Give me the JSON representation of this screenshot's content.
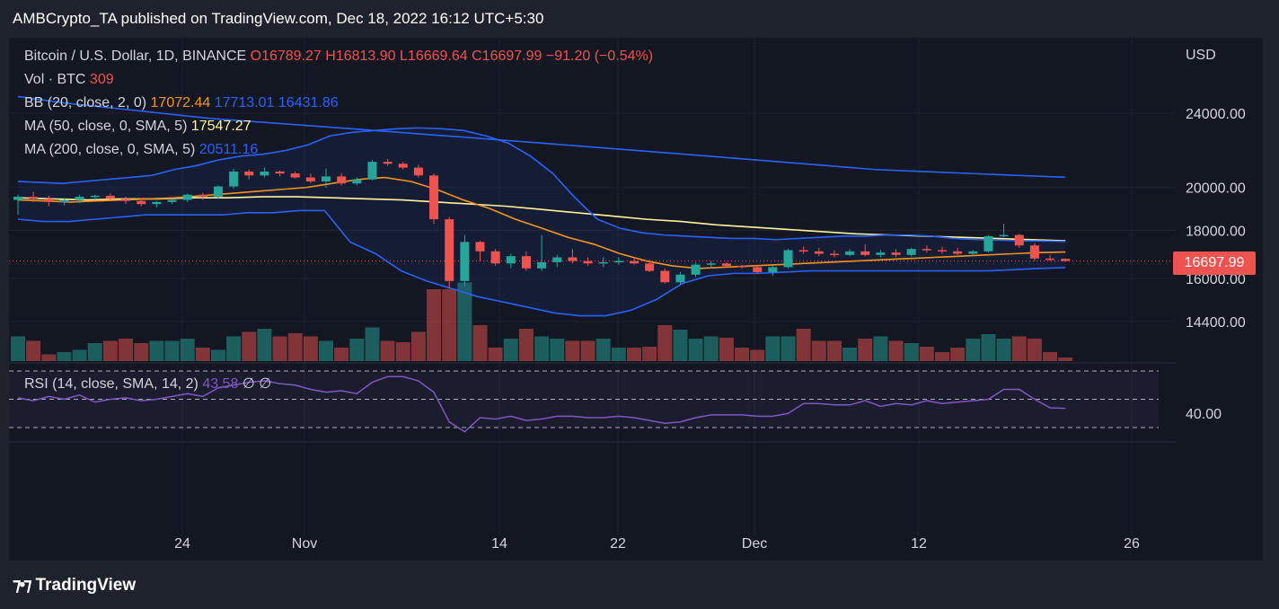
{
  "publisher_line": "AMBCrypto_TA published on TradingView.com, Dec 18, 2022 16:12 UTC+5:30",
  "legend": {
    "symbol": "Bitcoin / U.S. Dollar, 1D, BINANCE",
    "open": "O16789.27",
    "high": "H16813.90",
    "low": "L16669.64",
    "close": "C16697.99",
    "change": "−91.20 (−0.54%)",
    "vol_label": "Vol · BTC",
    "vol_value": "309",
    "bb_label": "BB (20, close, 2, 0)",
    "bb_basis": "17072.44",
    "bb_upper": "17713.01",
    "bb_lower": "16431.86",
    "ma50_label": "MA (50, close, 0, SMA, 5)",
    "ma50_value": "17547.27",
    "ma200_label": "MA (200, close, 0, SMA, 5)",
    "ma200_value": "20511.16",
    "rsi_label": "RSI (14, close, SMA, 14, 2)",
    "rsi_value": "43.58",
    "rsi_extra1": "∅",
    "rsi_extra2": "∅"
  },
  "price_axis": {
    "currency": "USD",
    "ticks": [
      "24000.00",
      "20000.00",
      "18000.00",
      "16000.00",
      "14400.00"
    ],
    "last_price": "16697.99",
    "rsi_tick": "40.00"
  },
  "time_axis": [
    "24",
    "Nov",
    "14",
    "22",
    "Dec",
    "12",
    "26"
  ],
  "footer": {
    "brand": "TradingView"
  },
  "colors": {
    "background": "#131722",
    "up": "#26a69a",
    "down": "#ef5350",
    "bb": "#2962ff",
    "bb_basis": "#f7931a",
    "ma50": "#fff59d",
    "ma200": "#2962ff",
    "rsi": "#7e57c2"
  },
  "chart_data": {
    "type": "candlestick",
    "symbol": "Bitcoin / U.S. Dollar",
    "interval": "1D",
    "exchange": "BINANCE",
    "y_axis_scale": "log",
    "ylim": [
      12800,
      26000
    ],
    "candles": [
      {
        "o": 19400,
        "h": 19650,
        "l": 18700,
        "c": 19550
      },
      {
        "o": 19550,
        "h": 19800,
        "l": 19300,
        "c": 19450
      },
      {
        "o": 19450,
        "h": 19600,
        "l": 19100,
        "c": 19300
      },
      {
        "o": 19300,
        "h": 19500,
        "l": 19150,
        "c": 19400
      },
      {
        "o": 19400,
        "h": 19650,
        "l": 19250,
        "c": 19550
      },
      {
        "o": 19550,
        "h": 19650,
        "l": 19400,
        "c": 19600
      },
      {
        "o": 19600,
        "h": 19700,
        "l": 19350,
        "c": 19450
      },
      {
        "o": 19450,
        "h": 19550,
        "l": 19200,
        "c": 19350
      },
      {
        "o": 19350,
        "h": 19500,
        "l": 19100,
        "c": 19200
      },
      {
        "o": 19200,
        "h": 19350,
        "l": 19050,
        "c": 19300
      },
      {
        "o": 19300,
        "h": 19450,
        "l": 19200,
        "c": 19400
      },
      {
        "o": 19400,
        "h": 19700,
        "l": 19300,
        "c": 19650
      },
      {
        "o": 19650,
        "h": 19750,
        "l": 19400,
        "c": 19550
      },
      {
        "o": 19550,
        "h": 20100,
        "l": 19450,
        "c": 20050
      },
      {
        "o": 20050,
        "h": 20950,
        "l": 19950,
        "c": 20800
      },
      {
        "o": 20800,
        "h": 20900,
        "l": 20400,
        "c": 20600
      },
      {
        "o": 20600,
        "h": 21000,
        "l": 20500,
        "c": 20800
      },
      {
        "o": 20800,
        "h": 20850,
        "l": 20550,
        "c": 20700
      },
      {
        "o": 20700,
        "h": 20800,
        "l": 20450,
        "c": 20500
      },
      {
        "o": 20500,
        "h": 20700,
        "l": 20200,
        "c": 20300
      },
      {
        "o": 20300,
        "h": 20950,
        "l": 20000,
        "c": 20550
      },
      {
        "o": 20550,
        "h": 20700,
        "l": 20100,
        "c": 20200
      },
      {
        "o": 20200,
        "h": 20500,
        "l": 20100,
        "c": 20400
      },
      {
        "o": 20400,
        "h": 21400,
        "l": 20350,
        "c": 21300
      },
      {
        "o": 21300,
        "h": 21450,
        "l": 21100,
        "c": 21200
      },
      {
        "o": 21200,
        "h": 21300,
        "l": 20900,
        "c": 21000
      },
      {
        "o": 21000,
        "h": 21150,
        "l": 20500,
        "c": 20600
      },
      {
        "o": 20600,
        "h": 20700,
        "l": 18300,
        "c": 18500
      },
      {
        "o": 18500,
        "h": 18600,
        "l": 15600,
        "c": 15900
      },
      {
        "o": 15900,
        "h": 17800,
        "l": 15700,
        "c": 17500
      },
      {
        "o": 17500,
        "h": 17550,
        "l": 16700,
        "c": 17100
      },
      {
        "o": 17100,
        "h": 17200,
        "l": 16500,
        "c": 16600
      },
      {
        "o": 16600,
        "h": 17000,
        "l": 16400,
        "c": 16900
      },
      {
        "o": 16900,
        "h": 17100,
        "l": 16300,
        "c": 16400
      },
      {
        "o": 16400,
        "h": 17800,
        "l": 16300,
        "c": 16650
      },
      {
        "o": 16650,
        "h": 16950,
        "l": 16450,
        "c": 16850
      },
      {
        "o": 16850,
        "h": 17200,
        "l": 16600,
        "c": 16700
      },
      {
        "o": 16700,
        "h": 16850,
        "l": 16500,
        "c": 16600
      },
      {
        "o": 16600,
        "h": 16850,
        "l": 16450,
        "c": 16650
      },
      {
        "o": 16650,
        "h": 16850,
        "l": 16550,
        "c": 16700
      },
      {
        "o": 16700,
        "h": 16850,
        "l": 16550,
        "c": 16600
      },
      {
        "o": 16600,
        "h": 16750,
        "l": 16250,
        "c": 16300
      },
      {
        "o": 16300,
        "h": 16400,
        "l": 15800,
        "c": 15850
      },
      {
        "o": 15850,
        "h": 16250,
        "l": 15750,
        "c": 16150
      },
      {
        "o": 16150,
        "h": 16650,
        "l": 16050,
        "c": 16550
      },
      {
        "o": 16550,
        "h": 16700,
        "l": 16400,
        "c": 16600
      },
      {
        "o": 16600,
        "h": 16650,
        "l": 16450,
        "c": 16500
      },
      {
        "o": 16500,
        "h": 16550,
        "l": 16400,
        "c": 16450
      },
      {
        "o": 16450,
        "h": 16550,
        "l": 16200,
        "c": 16250
      },
      {
        "o": 16250,
        "h": 16500,
        "l": 16100,
        "c": 16450
      },
      {
        "o": 16450,
        "h": 17200,
        "l": 16400,
        "c": 17150
      },
      {
        "o": 17150,
        "h": 17300,
        "l": 17000,
        "c": 17100
      },
      {
        "o": 17100,
        "h": 17250,
        "l": 16900,
        "c": 17000
      },
      {
        "o": 17000,
        "h": 17150,
        "l": 16850,
        "c": 16950
      },
      {
        "o": 16950,
        "h": 17200,
        "l": 16900,
        "c": 17100
      },
      {
        "o": 17100,
        "h": 17400,
        "l": 16900,
        "c": 16950
      },
      {
        "o": 16950,
        "h": 17150,
        "l": 16850,
        "c": 17050
      },
      {
        "o": 17050,
        "h": 17200,
        "l": 16850,
        "c": 16950
      },
      {
        "o": 16950,
        "h": 17250,
        "l": 16900,
        "c": 17200
      },
      {
        "o": 17200,
        "h": 17350,
        "l": 17050,
        "c": 17150
      },
      {
        "o": 17150,
        "h": 17300,
        "l": 17000,
        "c": 17100
      },
      {
        "o": 17100,
        "h": 17250,
        "l": 16950,
        "c": 17000
      },
      {
        "o": 17000,
        "h": 17150,
        "l": 16900,
        "c": 17100
      },
      {
        "o": 17100,
        "h": 17800,
        "l": 17050,
        "c": 17750
      },
      {
        "o": 17750,
        "h": 18300,
        "l": 17700,
        "c": 17800
      },
      {
        "o": 17800,
        "h": 17850,
        "l": 17250,
        "c": 17350
      },
      {
        "o": 17350,
        "h": 17450,
        "l": 16700,
        "c": 16800
      },
      {
        "o": 16800,
        "h": 16950,
        "l": 16700,
        "c": 16790
      },
      {
        "o": 16789.27,
        "h": 16813.9,
        "l": 16669.64,
        "c": 16697.99
      }
    ],
    "volume_relative": [
      0.55,
      0.45,
      0.15,
      0.2,
      0.25,
      0.4,
      0.45,
      0.5,
      0.4,
      0.45,
      0.45,
      0.5,
      0.3,
      0.25,
      0.55,
      0.65,
      0.72,
      0.55,
      0.62,
      0.55,
      0.45,
      0.3,
      0.5,
      0.75,
      0.45,
      0.42,
      0.65,
      1.6,
      1.6,
      1.75,
      0.8,
      0.3,
      0.5,
      0.72,
      0.55,
      0.5,
      0.45,
      0.45,
      0.5,
      0.3,
      0.3,
      0.32,
      0.8,
      0.7,
      0.5,
      0.55,
      0.52,
      0.3,
      0.25,
      0.55,
      0.55,
      0.72,
      0.45,
      0.45,
      0.3,
      0.5,
      0.55,
      0.45,
      0.4,
      0.32,
      0.2,
      0.3,
      0.5,
      0.6,
      0.5,
      0.55,
      0.5,
      0.2,
      0.08
    ],
    "bb_upper_line": [
      20300,
      20250,
      20200,
      20300,
      20400,
      20500,
      20600,
      20900,
      21100,
      21400,
      21600,
      21700,
      21900,
      22200,
      22700,
      22900,
      23000,
      23100,
      23150,
      23100,
      23000,
      22700,
      22300,
      21600,
      20700,
      19500,
      18500,
      18100,
      17900,
      17800,
      17750,
      17700,
      17650,
      17650,
      17600,
      17650,
      17700,
      17750,
      17750,
      17800,
      17800,
      17750,
      17650,
      17600,
      17580,
      17550,
      17540,
      17520
    ],
    "bb_lower_line": [
      18500,
      18400,
      18400,
      18500,
      18600,
      18700,
      18700,
      18700,
      18700,
      18800,
      18800,
      18900,
      18900,
      17500,
      17000,
      16300,
      15900,
      15600,
      15300,
      15100,
      14900,
      14700,
      14600,
      14600,
      14800,
      15200,
      15800,
      16100,
      16200,
      16200,
      16250,
      16300,
      16300,
      16300,
      16300,
      16300,
      16300,
      16300,
      16300,
      16350,
      16400,
      16431.86
    ],
    "bb_basis_line": [
      19400,
      19350,
      19300,
      19350,
      19400,
      19450,
      19500,
      19600,
      19700,
      19800,
      19900,
      20000,
      20200,
      20400,
      20500,
      20300,
      19900,
      19400,
      19000,
      18500,
      18100,
      17700,
      17400,
      17000,
      16700,
      16500,
      16400,
      16450,
      16500,
      16550,
      16600,
      16650,
      16700,
      16750,
      16800,
      16850,
      16900,
      16950,
      17000,
      17050,
      17072.44
    ],
    "ma50_line": [
      19500,
      19450,
      19400,
      19450,
      19450,
      19500,
      19500,
      19550,
      19550,
      19500,
      19450,
      19400,
      19300,
      19200,
      19100,
      18950,
      18800,
      18650,
      18500,
      18400,
      18250,
      18150,
      18050,
      17950,
      17850,
      17800,
      17750,
      17700,
      17650,
      17600,
      17547.27
    ],
    "ma200_line": [
      25000,
      24600,
      24300,
      24000,
      23700,
      23500,
      23300,
      23100,
      22900,
      22700,
      22500,
      22300,
      22100,
      21900,
      21700,
      21500,
      21300,
      21100,
      20900,
      20800,
      20700,
      20600,
      20511.16
    ],
    "rsi_values": [
      51,
      49,
      52,
      50,
      53,
      48,
      50,
      51,
      49,
      50,
      52,
      54,
      52,
      58,
      60,
      62,
      63,
      61,
      60,
      57,
      55,
      56,
      54,
      62,
      66,
      66,
      63,
      55,
      34,
      27,
      37,
      36,
      38,
      35,
      36,
      38,
      38,
      37,
      37,
      38,
      37,
      35,
      33,
      34,
      37,
      39,
      39,
      39,
      38,
      38,
      40,
      47,
      47,
      46,
      46,
      49,
      45,
      47,
      46,
      49,
      47,
      48,
      49,
      50,
      57,
      57,
      50,
      44,
      43.58
    ],
    "rsi_bands": [
      70,
      50,
      30
    ]
  }
}
